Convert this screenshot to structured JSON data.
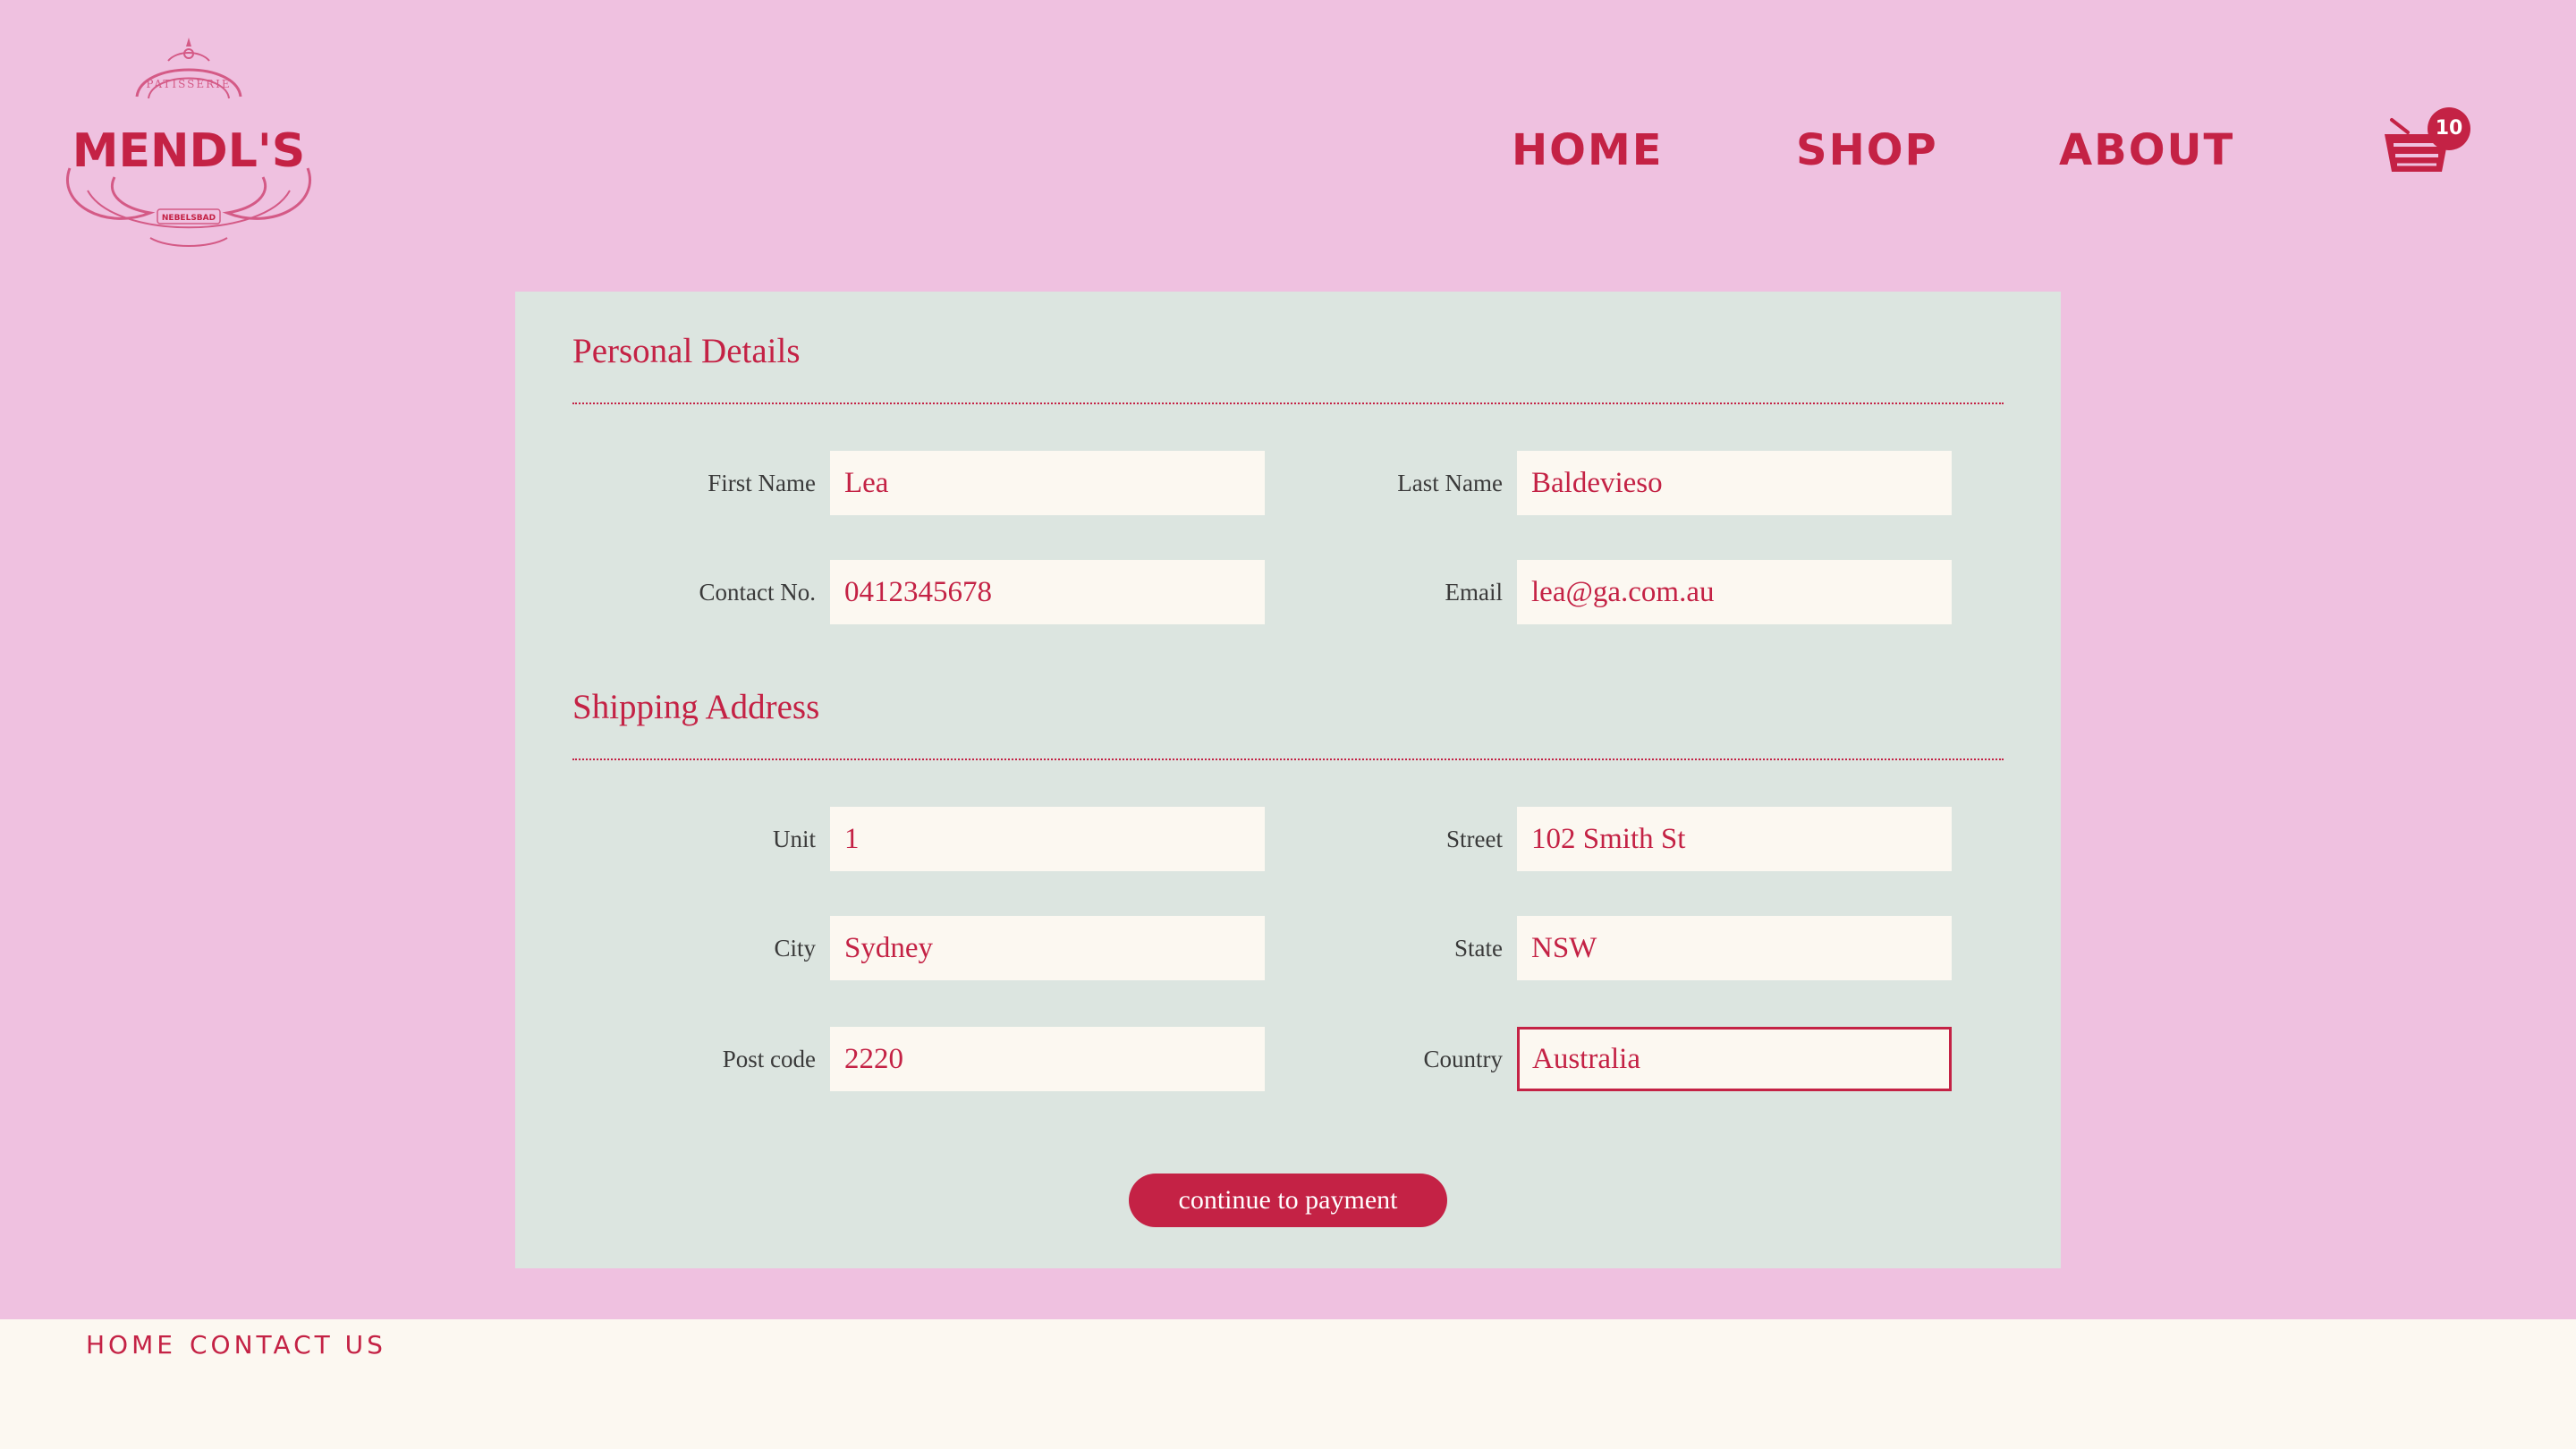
{
  "brand": {
    "logo_name": "MENDL'S",
    "logo_top": "PATISSERIE",
    "logo_bottom": "NEBELSBAD",
    "accent_color": "#c42245",
    "background_color": "#efc1e0",
    "panel_color": "#dce5e0",
    "input_color": "#fcf8f1"
  },
  "nav": {
    "home": "HOME",
    "shop": "SHOP",
    "about": "ABOUT",
    "cart_icon": "basket-icon",
    "cart_count": "10"
  },
  "personal": {
    "title": "Personal Details",
    "first_name_label": "First Name",
    "first_name": "Lea",
    "last_name_label": "Last Name",
    "last_name": "Baldevieso",
    "contact_label": "Contact No.",
    "contact": "0412345678",
    "email_label": "Email",
    "email": "lea@ga.com.au"
  },
  "shipping": {
    "title": "Shipping Address",
    "unit_label": "Unit",
    "unit": "1",
    "street_label": "Street",
    "street": "102 Smith St",
    "city_label": "City",
    "city": "Sydney",
    "state_label": "State",
    "state": "NSW",
    "postcode_label": "Post code",
    "postcode": "2220",
    "country_label": "Country",
    "country": "Australia"
  },
  "actions": {
    "continue_label": "continue to payment"
  },
  "footer": {
    "home": "HOME",
    "contact": "CONTACT US"
  }
}
